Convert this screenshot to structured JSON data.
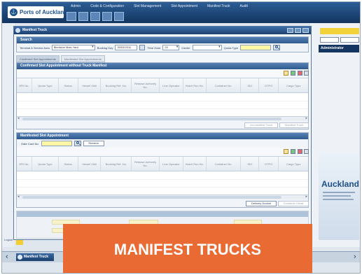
{
  "app": {
    "logo_text": "Ports of Auckland",
    "nav": [
      "Admin",
      "Code & Configuration",
      "Slot Management",
      "Slot Appointment",
      "Manifest Truck",
      "Audit"
    ]
  },
  "background": {
    "admin_label": "Administrator",
    "auckland_title": "Auckland",
    "logout_label": "Logout"
  },
  "window": {
    "title": "Manifest Truck",
    "search": {
      "header": "Search",
      "terminal_label": "Terminal & Service Area",
      "terminal_value": "Bledisloe Main Yard",
      "booking_day_label": "Booking Day",
      "booking_day_value": "30/03/2011",
      "time_zone_label": "Time Zone",
      "time_zone_value": "20",
      "carrier_label": "Carrier",
      "carrier_value": "",
      "quota_type_label": "Quota Type",
      "quota_type_value": ""
    },
    "subtabs": [
      "Confirmed Slot Appointments",
      "Manifested Slot Appointments"
    ],
    "confirmed": {
      "header": "Confirmed Slot Appointment without Truck Manifest",
      "columns": [
        "ERI No.",
        "Quota Type",
        "Status",
        "Vessel Visit",
        "Booking Ref. No.",
        "Release Authority No.",
        "Line Operator",
        "Hatch Run No.",
        "Container No.",
        "ISO",
        "DTPO",
        "Cargo Type"
      ],
      "buttons": [
        "Un-manifest Truck",
        "Manifest Truck"
      ]
    },
    "manifested": {
      "header": "Manifested Slot Appointment",
      "gate_card_label": "Gate Card No.",
      "gate_card_value": "",
      "retrieve_label": "Retrieve",
      "columns": [
        "ERI No.",
        "Quota Type",
        "Status",
        "Vessel Visit",
        "Booking Ref. No.",
        "Release Authority No.",
        "Line Operator",
        "Hatch Run No.",
        "Container No.",
        "ISO",
        "DTPO",
        "Cargo Type"
      ],
      "buttons": [
        "Delivery Docket",
        "Container Detail"
      ]
    }
  },
  "taskbar": {
    "tab_label": "Manifest Truck"
  },
  "banner": {
    "text": "MANIFEST TRUCKS"
  },
  "colors": {
    "banner": "#e96a32",
    "nav_bar": "#1d4576",
    "section_header": "#3f6a9e",
    "highlight_field": "#fdf7a6"
  }
}
